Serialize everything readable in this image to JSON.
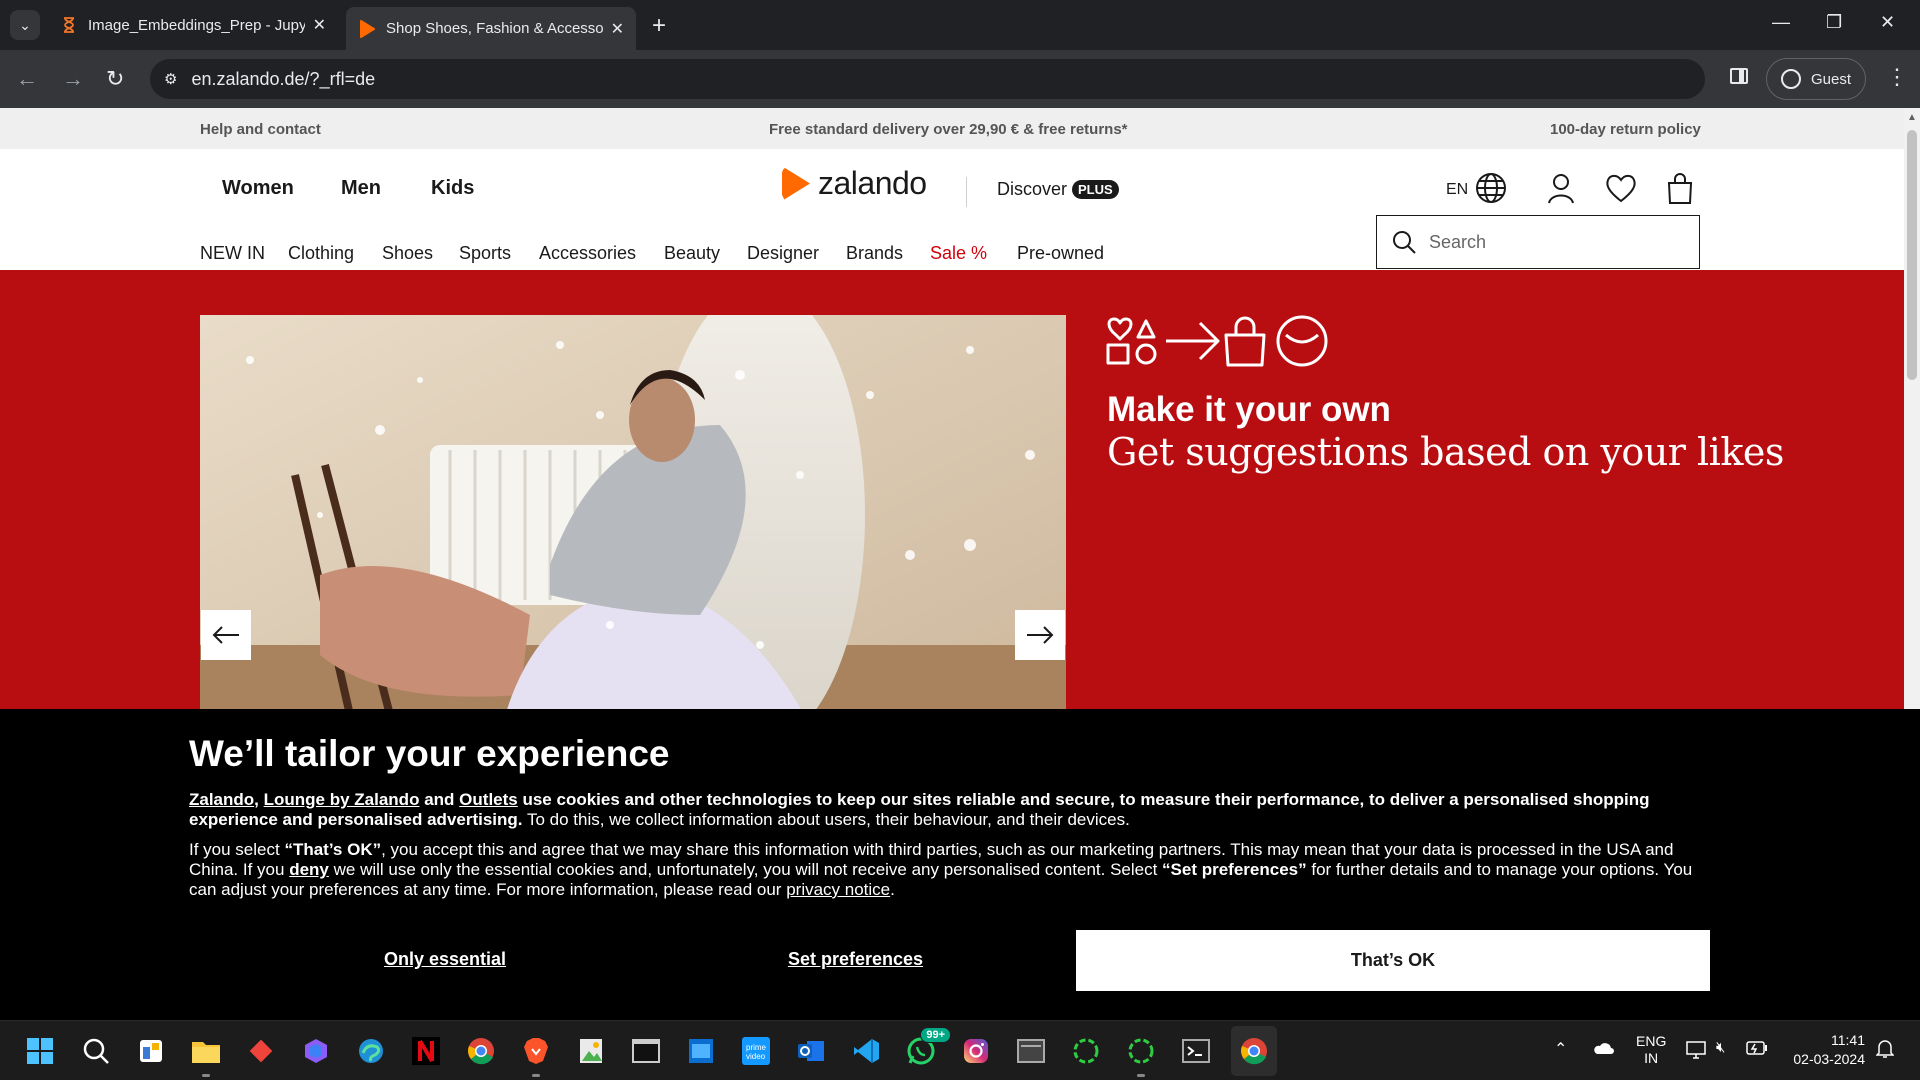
{
  "browser": {
    "tabs": [
      {
        "title": "Image_Embeddings_Prep - Jupyter",
        "active": false
      },
      {
        "title": "Shop Shoes, Fashion & Accessories",
        "active": true
      }
    ],
    "url": "en.zalando.de/?_rfl=de",
    "profile_label": "Guest"
  },
  "infobar": {
    "help": "Help and contact",
    "delivery": "Free standard delivery over 29,90 € & free returns*",
    "returns": "100-day return policy"
  },
  "header": {
    "genders": [
      "Women",
      "Men",
      "Kids"
    ],
    "logo_text": "zalando",
    "discover": "Discover",
    "plus": "PLUS",
    "lang": "EN",
    "categories": [
      "NEW IN",
      "Clothing",
      "Shoes",
      "Sports",
      "Accessories",
      "Beauty",
      "Designer",
      "Brands",
      "Sale %",
      "Pre-owned"
    ],
    "search_placeholder": "Search"
  },
  "hero": {
    "title": "Make it your own",
    "subtitle": "Get suggestions based on your likes"
  },
  "cookie": {
    "heading": "We’ll tailor your experience",
    "link_zalando": "Zalando",
    "link_lounge": "Lounge by Zalando",
    "and": "and",
    "link_outlets": "Outlets",
    "p1_bold": "use cookies and other technologies to keep our sites reliable and secure, to measure their performance, to deliver a personalised shopping experience and personalised advertising.",
    "p1_rest": "To do this, we collect information about users, their behaviour, and their devices.",
    "p2_a": "If you select",
    "p2_thatsok": "“That’s OK”",
    "p2_b": ", you accept this and agree that we may share this information with third parties, such as our marketing partners. This may mean that your data is processed in the USA and China. If you",
    "p2_deny": "deny",
    "p2_c": "we will use only the essential cookies and, unfortunately, you will not receive any personalised content. Select",
    "p2_setpref": "“Set preferences”",
    "p2_d": "for further details and to manage your options. You can adjust your preferences at any time. For more information, please read our",
    "p2_privacy": "privacy notice",
    "p2_end": ".",
    "btn_essential": "Only essential",
    "btn_preferences": "Set preferences",
    "btn_ok": "That’s OK"
  },
  "taskbar": {
    "whatsapp_badge": "99+",
    "lang_line1": "ENG",
    "lang_line2": "IN",
    "time": "11:41",
    "date": "02-03-2024"
  },
  "colors": {
    "brand_orange": "#ff6900",
    "hero_red": "#b80e12",
    "sale_red": "#d1000b"
  }
}
